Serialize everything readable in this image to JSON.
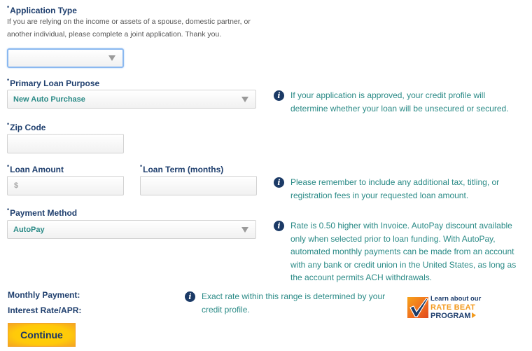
{
  "application_type": {
    "label": "Application Type",
    "required_marker": "*",
    "help_line1": "If you are relying on the income or assets of a spouse, domestic partner, or",
    "help_line2": "another individual, please complete a joint application. Thank you.",
    "value": ""
  },
  "primary_loan_purpose": {
    "label": "Primary Loan Purpose",
    "required_marker": "*",
    "value": "New Auto Purchase",
    "info": {
      "icon": "info-icon",
      "line1": "If your application is approved, your credit profile will",
      "line2": "determine whether your loan will be unsecured or secured."
    }
  },
  "zip_code": {
    "label": "Zip Code",
    "required_marker": "*",
    "value": ""
  },
  "loan_amount": {
    "label": "Loan Amount",
    "required_marker": "*",
    "prefix": "$",
    "value": ""
  },
  "loan_term": {
    "label": "Loan Term (months)",
    "required_marker": "*",
    "value": ""
  },
  "loan_info": {
    "icon": "info-icon",
    "line1": "Please remember to include any additional tax, titling, or",
    "line2": "registration fees in your requested loan amount."
  },
  "payment_method": {
    "label": "Payment Method",
    "required_marker": "*",
    "value": "AutoPay",
    "info": {
      "icon": "info-icon",
      "line1": "Rate is 0.50 higher with Invoice. AutoPay discount available",
      "line2": "only when selected prior to loan funding. With AutoPay,",
      "line3": "automated monthly payments can be made from an account",
      "line4": "with any bank or credit union in the United States, as long as",
      "line5": "the account permits ACH withdrawals."
    }
  },
  "summary": {
    "monthly_payment_label": "Monthly Payment:",
    "interest_rate_label": "Interest Rate/APR:",
    "info": {
      "icon": "info-icon",
      "line1": "Exact rate within this range is determined by your",
      "line2": "credit profile."
    }
  },
  "rate_beat": {
    "line1": "Learn about our",
    "line2": "RATE BEAT",
    "line3": "PROGRAM",
    "icon": "checkmark-icon"
  },
  "continue_button": {
    "label": "Continue"
  },
  "colors": {
    "label_navy": "#1f3f6e",
    "info_teal": "#2a8a86",
    "button_yellow": "#ffd400",
    "button_orange": "#f4a423"
  }
}
